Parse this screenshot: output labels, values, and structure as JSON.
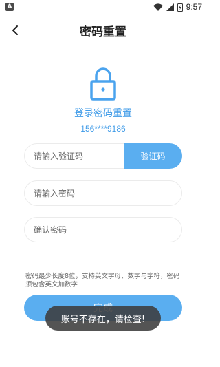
{
  "status_bar": {
    "left_badge": "A",
    "time": "9:57",
    "icons": [
      "wifi-icon",
      "signal-icon",
      "battery-icon"
    ]
  },
  "header": {
    "title": "密码重置",
    "back_icon": "chevron-left-icon"
  },
  "hero": {
    "icon": "lock-icon",
    "heading": "登录密码重置",
    "phone": "156****9186"
  },
  "form": {
    "code_placeholder": "请输入验证码",
    "code_button": "验证码",
    "password_placeholder": "请输入密码",
    "confirm_placeholder": "确认密码",
    "hint": "密码最少长度8位，支持英文字母、数字与字符，密码须包含英文加数字",
    "submit_label": "完成"
  },
  "toast": {
    "message": "账号不存在，请检查!"
  },
  "colors": {
    "accent": "#5aaef0",
    "accent_text": "#3f9be8",
    "toast_bg": "#3c3c3c"
  }
}
